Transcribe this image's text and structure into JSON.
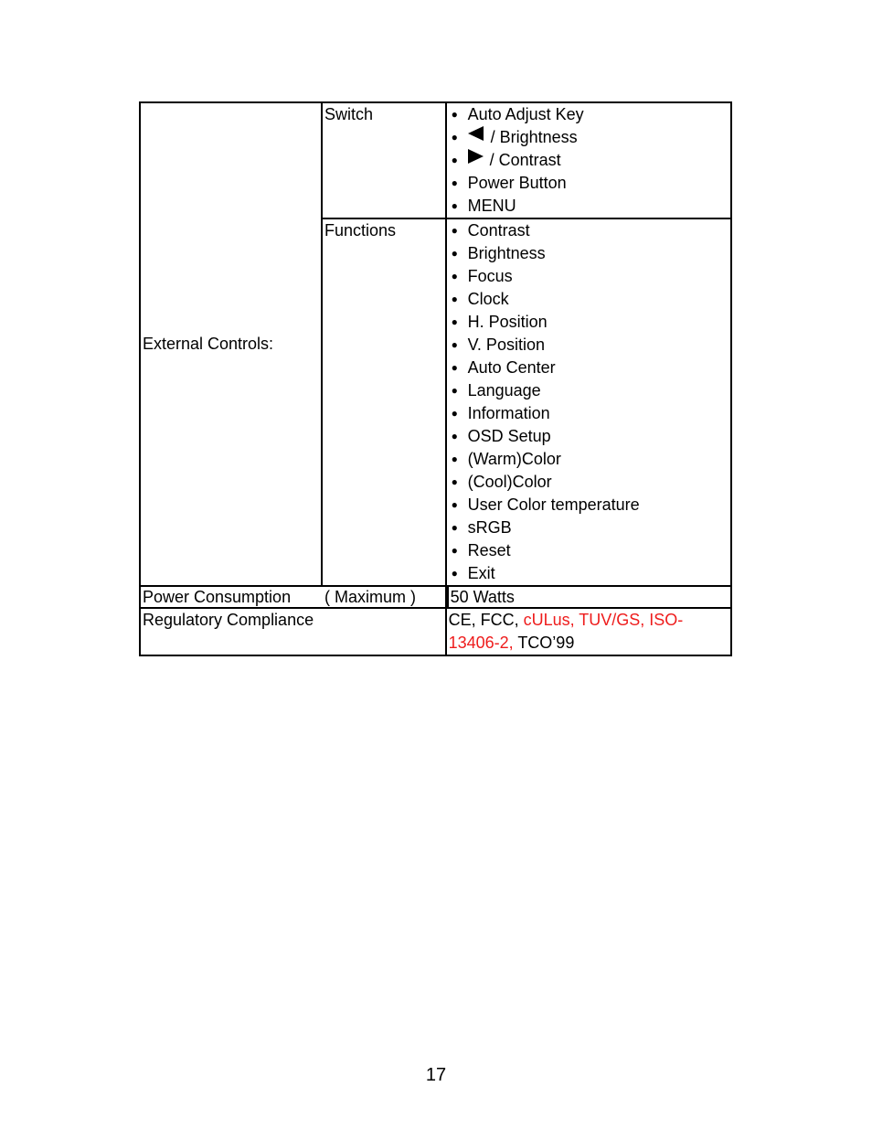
{
  "table": {
    "external_controls": {
      "label": "External Controls:",
      "switch": {
        "label": "Switch",
        "items": [
          {
            "icon": "",
            "text": "Auto Adjust Key"
          },
          {
            "icon": "left-triangle-icon",
            "text": "/ Brightness"
          },
          {
            "icon": "right-triangle-icon",
            "text": "/ Contrast"
          },
          {
            "icon": "",
            "text": "Power Button"
          },
          {
            "icon": "",
            "text": "MENU"
          }
        ]
      },
      "functions": {
        "label": "Functions",
        "items": [
          "Contrast",
          "Brightness",
          "Focus",
          "Clock",
          "H. Position",
          "V. Position",
          "Auto Center",
          "Language",
          "Information",
          "OSD Setup",
          "(Warm)Color",
          "(Cool)Color",
          "User Color temperature",
          "sRGB",
          "Reset",
          "Exit"
        ]
      }
    },
    "power_consumption": {
      "label": "Power Consumption",
      "qualifier": "( Maximum )",
      "value": "50 Watts"
    },
    "regulatory_compliance": {
      "label": "Regulatory Compliance",
      "value_parts": [
        {
          "text": "CE, FCC, ",
          "color": "#000000"
        },
        {
          "text": "cULus, TUV/GS, ISO-13406-2,",
          "color": "#ee1c1c"
        },
        {
          "text": " TCO’99",
          "color": "#000000"
        }
      ]
    }
  },
  "bullet_char": "●",
  "page_number": "17"
}
